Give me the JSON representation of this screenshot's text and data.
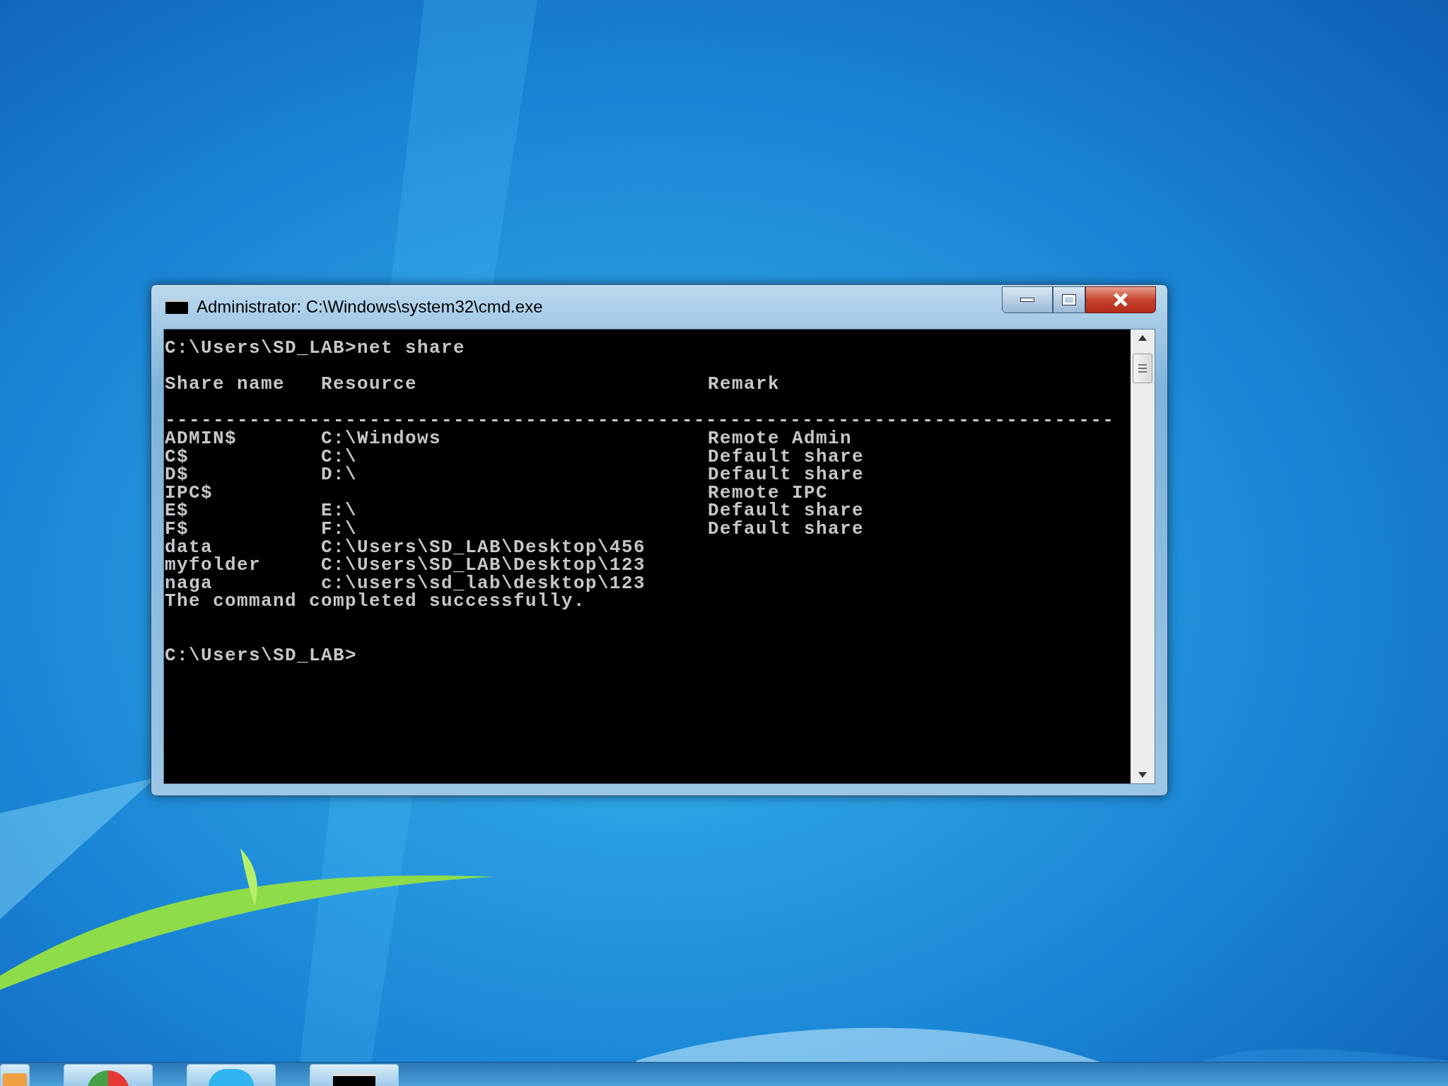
{
  "window": {
    "title": "Administrator: C:\\Windows\\system32\\cmd.exe"
  },
  "console": {
    "command_line": "C:\\Users\\SD_LAB>net share",
    "columns": [
      "Share name",
      "Resource",
      "Remark"
    ],
    "separator": "-------------------------------------------------------------------------------",
    "rows": [
      {
        "share": "ADMIN$",
        "resource": "C:\\Windows",
        "remark": "Remote Admin"
      },
      {
        "share": "C$",
        "resource": "C:\\",
        "remark": "Default share"
      },
      {
        "share": "D$",
        "resource": "D:\\",
        "remark": "Default share"
      },
      {
        "share": "IPC$",
        "remark": "Remote IPC"
      },
      {
        "share": "E$",
        "resource": "E:\\",
        "remark": "Default share"
      },
      {
        "share": "F$",
        "resource": "F:\\",
        "remark": "Default share"
      },
      {
        "share": "data",
        "resource": "C:\\Users\\SD_LAB\\Desktop\\456"
      },
      {
        "share": "myfolder",
        "resource": "C:\\Users\\SD_LAB\\Desktop\\123"
      },
      {
        "share": "naga",
        "resource": "c:\\users\\sd_lab\\desktop\\123"
      }
    ],
    "message": "The command completed successfully.",
    "prompt": "C:\\Users\\SD_LAB>"
  },
  "taskbar": {
    "items": [
      {
        "kind": "folder"
      },
      {
        "kind": "browser"
      },
      {
        "kind": "chat"
      },
      {
        "kind": "console"
      }
    ]
  }
}
